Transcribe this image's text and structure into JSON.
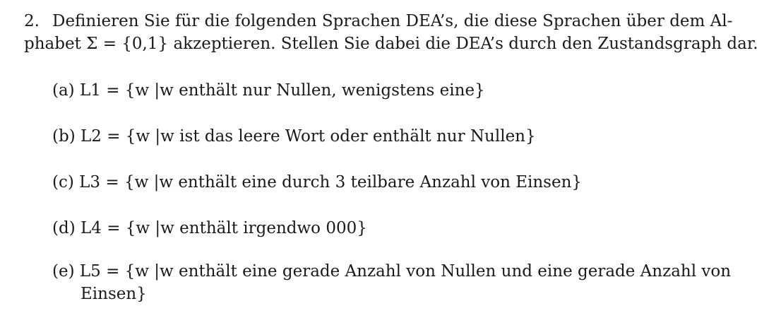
{
  "exercise": {
    "number": "2.",
    "intro_line1": "Definieren Sie für die folgenden Sprachen DEA’s, die diese Sprachen über dem Al-",
    "intro_line2": "phabet Σ = {0,1} akzeptieren. Stellen Sie dabei die DEA’s durch den Zustandsgraph dar.",
    "items": [
      {
        "label": "(a)",
        "text": "L1 = {w |w enthält nur Nullen, wenigstens eine}",
        "continuation": ""
      },
      {
        "label": "(b)",
        "text": "L2 = {w |w ist das leere Wort oder enthält nur Nullen}",
        "continuation": ""
      },
      {
        "label": "(c)",
        "text": "L3 = {w |w enthält eine durch 3 teilbare Anzahl von Einsen}",
        "continuation": ""
      },
      {
        "label": "(d)",
        "text": "L4 = {w |w enthält irgendwo 000}",
        "continuation": ""
      },
      {
        "label": "(e)",
        "text": "L5 = {w |w enthält eine gerade Anzahl von Nullen und eine gerade Anzahl von",
        "continuation": "Einsen}"
      }
    ]
  }
}
